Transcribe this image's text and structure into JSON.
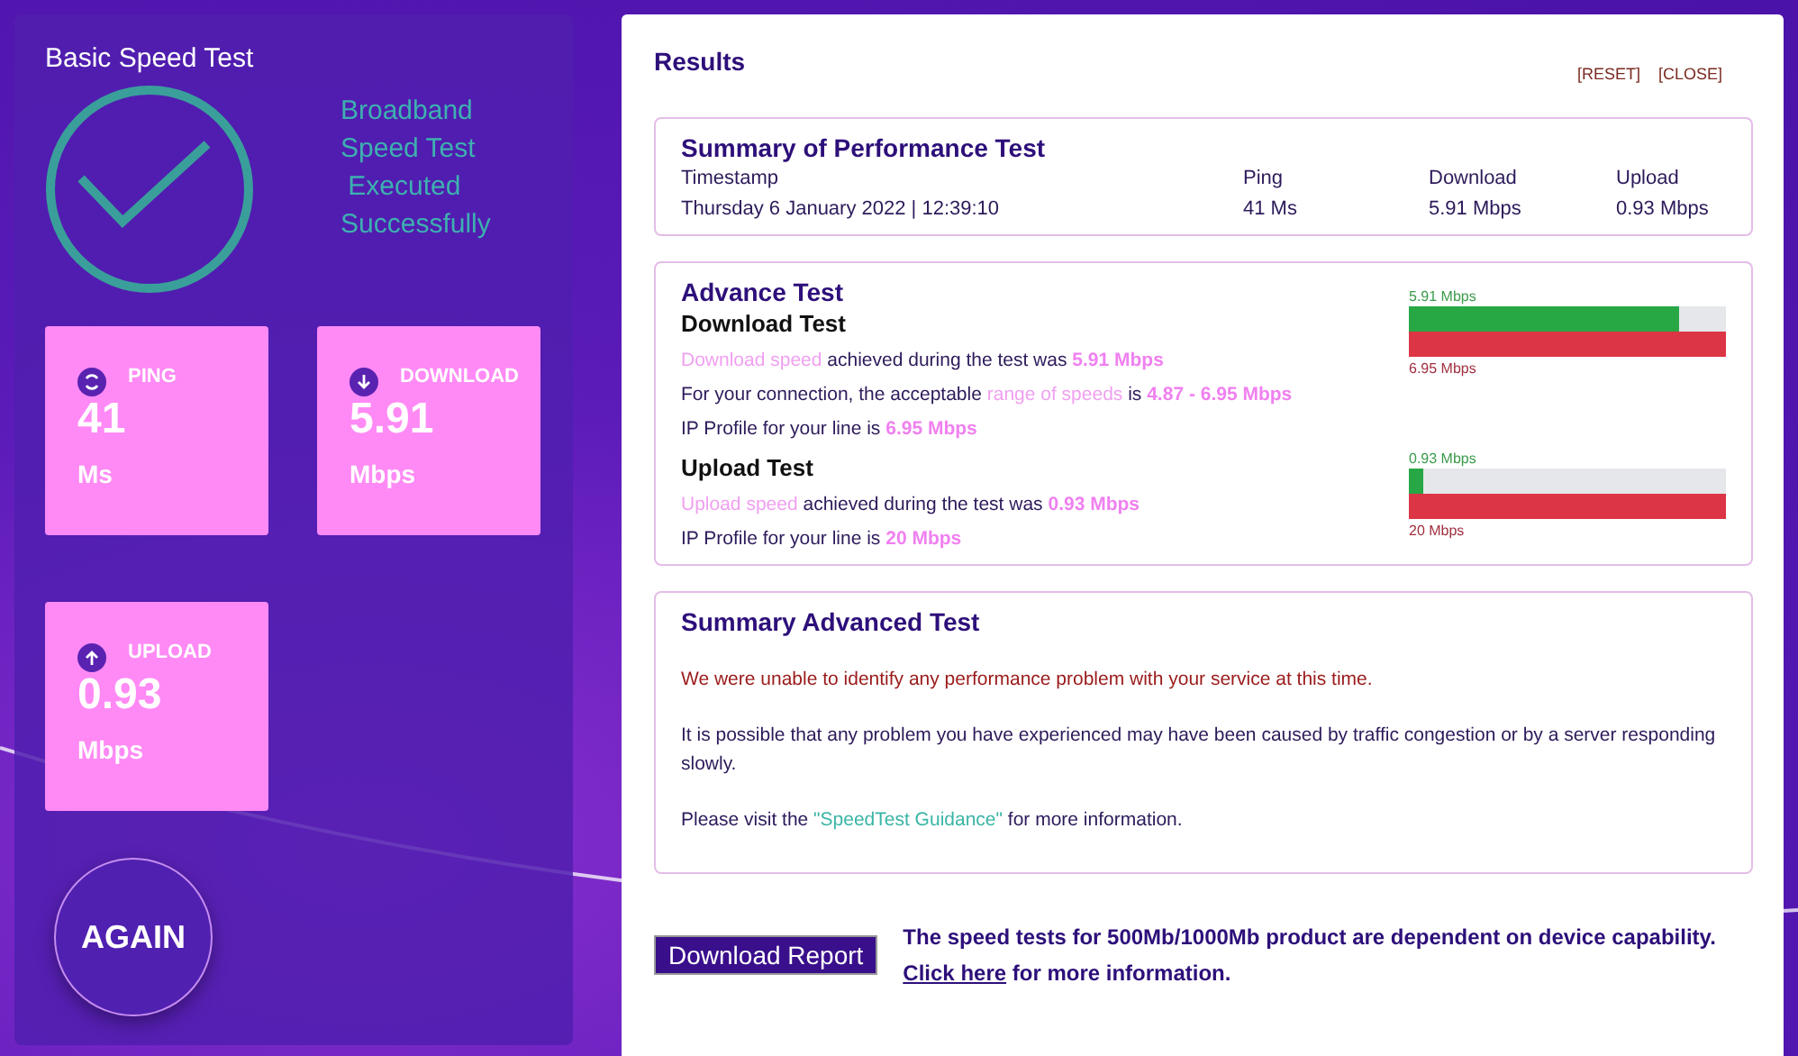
{
  "left_panel": {
    "title": "Basic Speed Test",
    "status_lines": [
      "Broadband",
      "Speed Test",
      " Executed",
      "Successfully"
    ],
    "tiles": [
      {
        "kind": "ping",
        "label": "PING",
        "value": "41",
        "unit": "Ms"
      },
      {
        "kind": "download",
        "label": "DOWNLOAD",
        "value": "5.91",
        "unit": "Mbps"
      },
      {
        "kind": "upload",
        "label": "UPLOAD",
        "value": "0.93",
        "unit": "Mbps"
      }
    ],
    "again_button": "AGAIN"
  },
  "results": {
    "title": "Results",
    "actions": [
      "[RESET]",
      "[CLOSE]"
    ],
    "summary": {
      "title": "Summary of Performance Test",
      "columns": [
        "Timestamp",
        "Ping",
        "Download",
        "Upload"
      ],
      "values": [
        "Thursday 6 January 2022 | 12:39:10",
        "41 Ms",
        "5.91 Mbps",
        "0.93 Mbps"
      ]
    },
    "advance": {
      "title": "Advance Test",
      "tests": [
        {
          "title": "Download Test",
          "lines": [
            [
              {
                "kind": "term",
                "text": "Download speed"
              },
              {
                "kind": "plain",
                "text": " achieved during the test was "
              },
              {
                "kind": "value",
                "text": "5.91 Mbps"
              }
            ],
            [
              {
                "kind": "plain",
                "text": "For your connection, the acceptable "
              },
              {
                "kind": "term",
                "text": "range of speeds"
              },
              {
                "kind": "plain",
                "text": " is "
              },
              {
                "kind": "value",
                "text": "4.87 - 6.95 Mbps"
              }
            ],
            [
              {
                "kind": "plain",
                "text": "IP Profile for your line is "
              },
              {
                "kind": "value",
                "text": "6.95 Mbps"
              }
            ]
          ],
          "measured_label": "5.91 Mbps",
          "level": 0.85,
          "profile_label": "6.95 Mbps"
        },
        {
          "title": "Upload Test",
          "lines": [
            [
              {
                "kind": "term",
                "text": "Upload speed"
              },
              {
                "kind": "plain",
                "text": " achieved during the test was "
              },
              {
                "kind": "value",
                "text": "0.93 Mbps"
              }
            ],
            [
              {
                "kind": "plain",
                "text": "IP Profile for your line is "
              },
              {
                "kind": "value",
                "text": "20 Mbps"
              }
            ]
          ],
          "measured_label": "0.93 Mbps",
          "level": 0.047,
          "profile_label": "20 Mbps"
        }
      ]
    },
    "summary_advanced": {
      "title": "Summary Advanced Test",
      "warning": "We were unable to identify any performance problem with your service at this time.",
      "note": "It is possible that any problem you have experienced may have been caused by traffic congestion or by a server responding slowly.",
      "visit_before": "Please visit the ",
      "visit_link": "\"SpeedTest Guidance\"",
      "visit_after": " for more information."
    },
    "download_report": "Download Report",
    "footer": {
      "text": "The speed tests for 500Mb/1000Mb product are dependent on device capability.",
      "link": "Click here",
      "after": " for more information."
    }
  }
}
